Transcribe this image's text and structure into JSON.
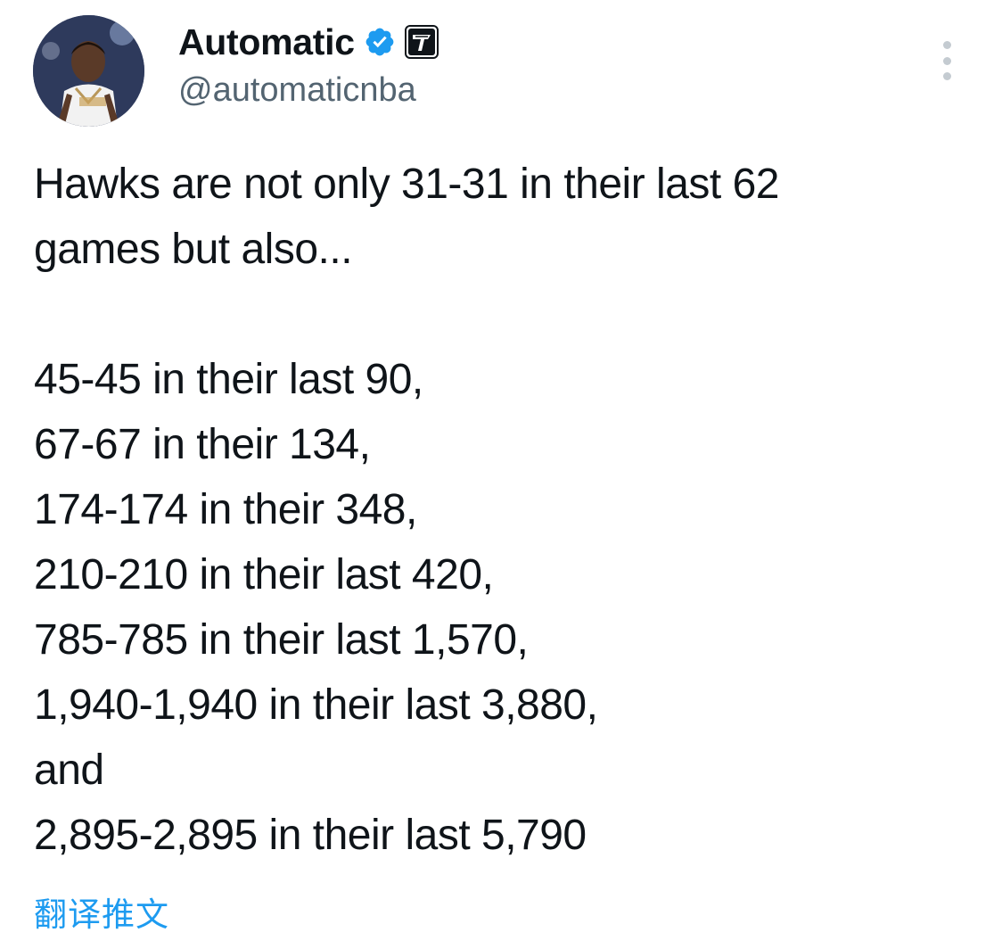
{
  "author": {
    "display_name": "Automatic",
    "handle": "@automaticnba",
    "verified_icon": "verified-check-icon",
    "affiliate_icon": "affiliate-badge-icon",
    "verified_color": "#1d9bf0"
  },
  "menu": {
    "icon": "more-options-icon"
  },
  "tweet": {
    "lines": [
      "Hawks are not only 31-31 in their last 62",
      "games but also...",
      "",
      "45-45 in their last 90,",
      "67-67 in their 134,",
      "174-174 in their 348,",
      "210-210 in their last 420,",
      "785-785 in their last 1,570,",
      "1,940-1,940 in their last 3,880,",
      "and",
      "2,895-2,895 in their last 5,790"
    ]
  },
  "translate": {
    "label": "翻译推文",
    "color": "#1d9bf0"
  }
}
